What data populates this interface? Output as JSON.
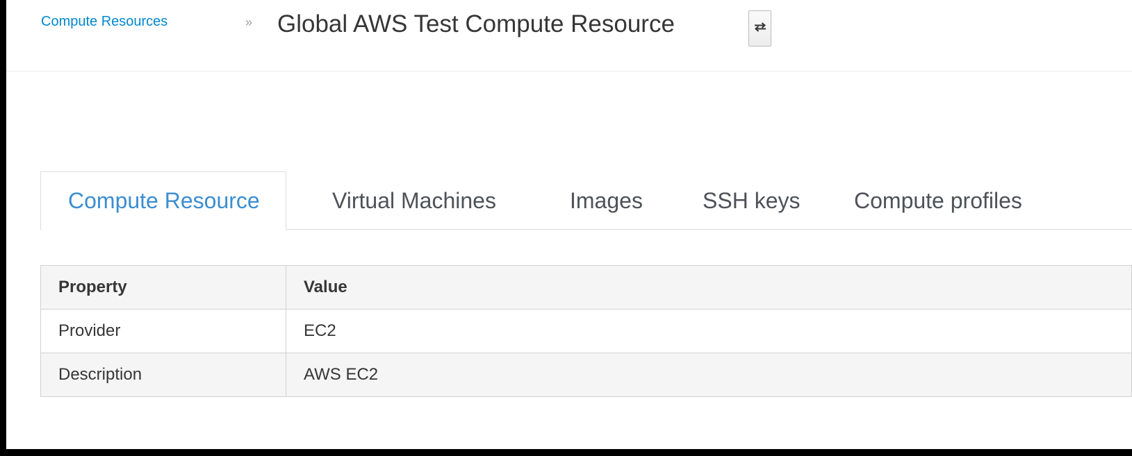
{
  "breadcrumb": {
    "parent_label": "Compute Resources",
    "separator": "»",
    "current_title": "Global AWS Test Compute Resource",
    "switcher_icon": "exchange-icon"
  },
  "tabs": [
    {
      "label": "Compute Resource",
      "active": true
    },
    {
      "label": "Virtual Machines",
      "active": false
    },
    {
      "label": "Images",
      "active": false
    },
    {
      "label": "SSH keys",
      "active": false
    },
    {
      "label": "Compute profiles",
      "active": false
    }
  ],
  "table": {
    "headers": [
      "Property",
      "Value"
    ],
    "rows": [
      [
        "Provider",
        "EC2"
      ],
      [
        "Description",
        "AWS EC2"
      ]
    ]
  },
  "colors": {
    "link": "#0088ce",
    "active_tab": "#3b8ed0",
    "text": "#363636"
  }
}
